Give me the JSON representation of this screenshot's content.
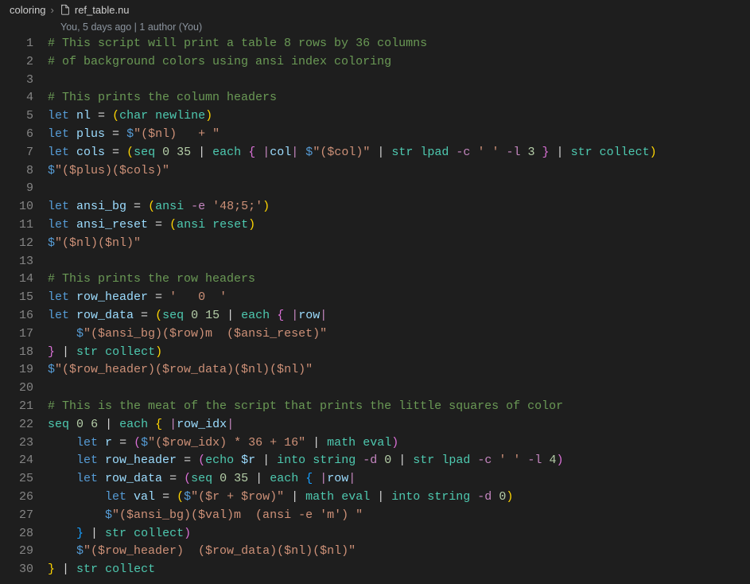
{
  "breadcrumb": {
    "folder": "coloring",
    "file": "ref_table.nu"
  },
  "codelens": "You, 5 days ago | 1 author (You)",
  "line_numbers": [
    "1",
    "2",
    "3",
    "4",
    "5",
    "6",
    "7",
    "8",
    "9",
    "10",
    "11",
    "12",
    "13",
    "14",
    "15",
    "16",
    "17",
    "18",
    "19",
    "20",
    "21",
    "22",
    "23",
    "24",
    "25",
    "26",
    "27",
    "28",
    "29",
    "30"
  ],
  "tok": {
    "c1": "# This script will print a table 8 rows by 36 columns",
    "c2": "# of background colors using ansi index coloring",
    "c4": "# This prints the column headers",
    "let": "let",
    "nl": "nl",
    "eq": " = ",
    "char": "char",
    "newline": "newline",
    "plus": "plus",
    "plus_str": "\"($nl)   + \"",
    "cols": "cols",
    "seq": "seq",
    "n0": "0",
    "n35": "35",
    "each": "each",
    "col": "col",
    "col_str": "\"($col)\"",
    "str": "str",
    "lpad": "lpad",
    "dc": "-c",
    "sp_q": "' '",
    "dl": "-l",
    "n3": "3",
    "collect": "collect",
    "l8": "\"($plus)($cols)\"",
    "ansi_bg": "ansi_bg",
    "ansi": "ansi",
    "de": "-e",
    "bgcode": "'48;5;'",
    "ansi_reset": "ansi_reset",
    "reset": "reset",
    "l12": "\"($nl)($nl)\"",
    "c14": "# This prints the row headers",
    "row_header": "row_header",
    "rh_str": "'   0  '",
    "row_data": "row_data",
    "n15": "15",
    "row": "row",
    "l17": "\"($ansi_bg)($row)m  ($ansi_reset)\"",
    "l19": "\"($row_header)($row_data)($nl)($nl)\"",
    "c21": "# This is the meat of the script that prints the little squares of color",
    "n6": "6",
    "row_idx": "row_idx",
    "r": "r",
    "r_expr": "\"($row_idx) * 36 + 16\"",
    "math": "math",
    "eval": "eval",
    "echo": "echo",
    "dr": "$r",
    "into": "into",
    "string": "string",
    "dd": "-d",
    "n4": "4",
    "val": "val",
    "val_expr": "\"($r + $row)\"",
    "l27": "\"($ansi_bg)($val)m  (ansi -e 'm') \"",
    "l29": "\"($row_header)  ($row_data)($nl)($nl)\"",
    "dollar": "$",
    "pipe": " | ",
    "ob": "{",
    "cb": "}",
    "op": "(",
    "cp": ")",
    "bar": "|"
  }
}
